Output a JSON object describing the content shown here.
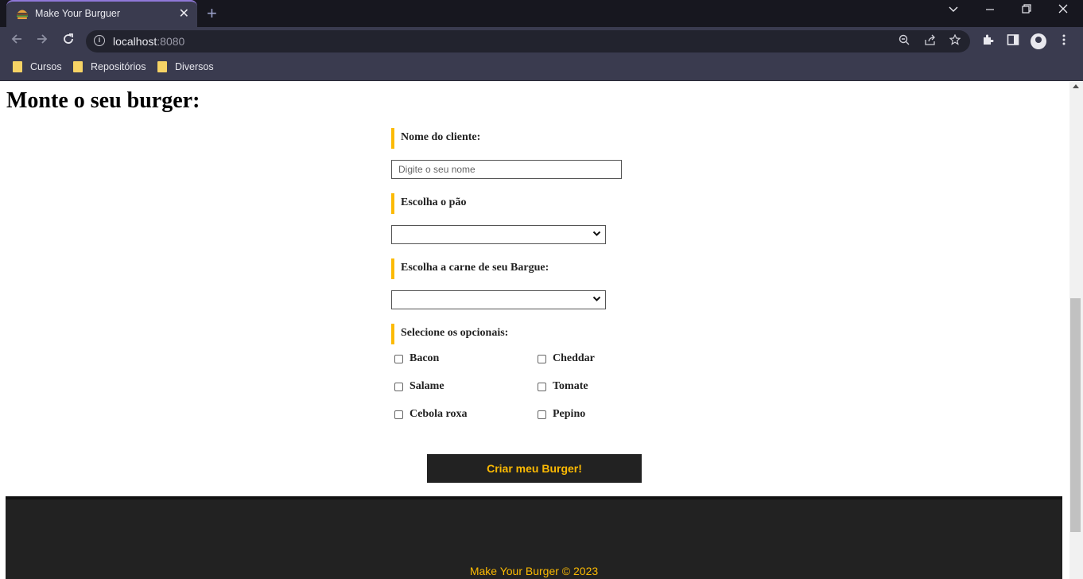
{
  "browser": {
    "tab_title": "Make Your Burguer",
    "tab_close": "✕",
    "new_tab": "+",
    "url_host": "localhost",
    "url_port": ":8080",
    "bookmarks": [
      "Cursos",
      "Repositórios",
      "Diversos"
    ]
  },
  "page": {
    "title": "Monte o seu burger:",
    "form": {
      "name_label": "Nome do cliente:",
      "name_placeholder": "Digite o seu nome",
      "name_value": "",
      "bread_label": "Escolha o pão",
      "bread_selected": "",
      "meat_label": "Escolha a carne de seu Bargue:",
      "meat_selected": "",
      "optionals_label": "Selecione os opcionais:",
      "optionals": [
        {
          "label": "Bacon",
          "checked": false
        },
        {
          "label": "Cheddar",
          "checked": false
        },
        {
          "label": "Salame",
          "checked": false
        },
        {
          "label": "Tomate",
          "checked": false
        },
        {
          "label": "Cebola roxa",
          "checked": false
        },
        {
          "label": "Pepino",
          "checked": false
        }
      ],
      "submit_label": "Criar meu Burger!"
    },
    "footer_text": "Make Your Burger © 2023"
  },
  "colors": {
    "accent": "#fcba03",
    "dark": "#222222"
  }
}
